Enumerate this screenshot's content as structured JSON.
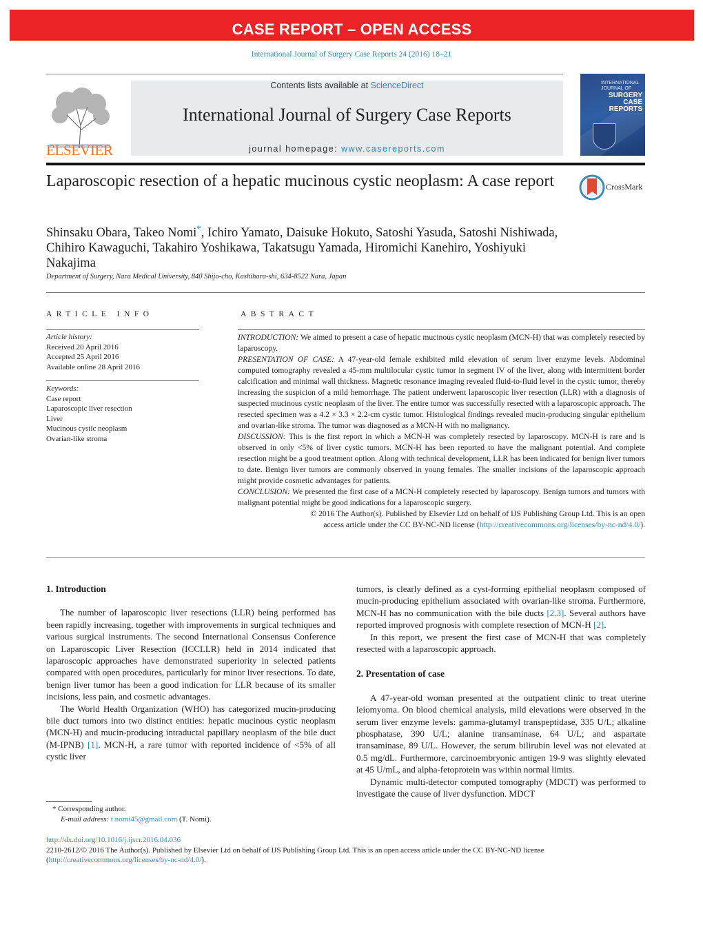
{
  "banner": "CASE REPORT – OPEN ACCESS",
  "citation": "International Journal of Surgery Case Reports 24 (2016) 18–21",
  "masthead": {
    "contents_prefix": "Contents lists available at ",
    "contents_link": "ScienceDirect",
    "journal_name": "International Journal of Surgery Case Reports",
    "homepage_prefix": "journal homepage: ",
    "homepage_link": "www.casereports.com",
    "publisher_logo": "ELSEVIER",
    "cover_line1": "INTERNATIONAL JOURNAL OF",
    "cover_line2": "SURGERY CASE REPORTS"
  },
  "article": {
    "title": "Laparoscopic resection of a hepatic mucinous cystic neoplasm: A case report",
    "crossmark_label": "CrossMark",
    "authors_part1": "Shinsaku Obara, Takeo Nomi",
    "corresponding_mark": "*",
    "authors_part2": ", Ichiro Yamato, Daisuke Hokuto, Satoshi Yasuda, Satoshi Nishiwada, Chihiro Kawaguchi, Takahiro Yoshikawa, Takatsugu Yamada, Hiromichi Kanehiro, Yoshiyuki Nakajima",
    "affiliation": "Department of Surgery, Nara Medical University, 840 Shijo-cho, Kashihara-shi, 634-8522 Nara, Japan"
  },
  "article_info": {
    "heading": "ARTICLE INFO",
    "history_label": "Article history:",
    "history": [
      "Received 20 April 2016",
      "Accepted 25 April 2016",
      "Available online 28 April 2016"
    ],
    "keywords_label": "Keywords:",
    "keywords": [
      "Case report",
      "Laparoscopic liver resection",
      "Liver",
      "Mucinous cystic neoplasm",
      "Ovarian-like stroma"
    ]
  },
  "abstract": {
    "heading": "ABSTRACT",
    "sections": [
      {
        "label": "INTRODUCTION:",
        "text": " We aimed to present a case of hepatic mucinous cystic neoplasm (MCN-H) that was completely resected by laparoscopy."
      },
      {
        "label": "PRESENTATION OF CASE:",
        "text": " A 47-year-old female exhibited mild elevation of serum liver enzyme levels. Abdominal computed tomography revealed a 45-mm multilocular cystic tumor in segment IV of the liver, along with intermittent border calcification and minimal wall thickness. Magnetic resonance imaging revealed fluid-to-fluid level in the cystic tumor, thereby increasing the suspicion of a mild hemorrhage. The patient underwent laparoscopic liver resection (LLR) with a diagnosis of suspected mucinous cystic neoplasm of the liver. The entire tumor was successfully resected with a laparoscopic approach. The resected specimen was a 4.2 × 3.3 × 2.2-cm cystic tumor. Histological findings revealed mucin-producing singular epithelium and ovarian-like stroma. The tumor was diagnosed as a MCN-H with no malignancy."
      },
      {
        "label": "DISCUSSION:",
        "text": " This is the first report in which a MCN-H was completely resected by laparoscopy. MCN-H is rare and is observed in only <5% of liver cystic tumors. MCN-H has been reported to have the malignant potential. And complete resection might be a good treatment option. Along with technical development, LLR has been indicated for benign liver tumors to date. Benign liver tumors are commonly observed in young females. The smaller incisions of the laparoscopic approach might provide cosmetic advantages for patients."
      },
      {
        "label": "CONCLUSION:",
        "text": " We presented the first case of a MCN-H completely resected by laparoscopy. Benign tumors and tumors with malignant potential might be good indications for a laparoscopic surgery."
      }
    ],
    "copyright_line1": "© 2016 The Author(s). Published by Elsevier Ltd on behalf of IJS Publishing Group Ltd. This is an open",
    "copyright_line2_prefix": "access article under the CC BY-NC-ND license (",
    "license_link": "http://creativecommons.org/licenses/by-nc-nd/4.0/",
    "copyright_line2_suffix": ")."
  },
  "body": {
    "intro_heading": "1.  Introduction",
    "intro_p1": "The number of laparoscopic liver resections (LLR) being performed has been rapidly increasing, together with improvements in surgical techniques and various surgical instruments. The second International Consensus Conference on Laparoscopic Liver Resection (ICCLLR) held in 2014 indicated that laparoscopic approaches have demonstrated superiority in selected patients compared with open procedures, particularly for minor liver resections. To date, benign liver tumor has been a good indication for LLR because of its smaller incisions, less pain, and cosmetic advantages.",
    "intro_p2_a": "The World Health Organization (WHO) has categorized mucin-producing bile duct tumors into two distinct entities: hepatic mucinous cystic neoplasm (MCN-H) and mucin-producing intraductal papillary neoplasm of the bile duct (M-IPNB) ",
    "ref1": "[1]",
    "intro_p2_b": ". MCN-H, a rare tumor with reported incidence of <5% of all cystic liver",
    "intro_p2_c": "tumors, is clearly defined as a cyst-forming epithelial neoplasm composed of mucin-producing epithelium associated with ovarian-like stroma. Furthermore, MCN-H has no communication with the bile ducts ",
    "ref23": "[2,3]",
    "intro_p2_d": ". Several authors have reported improved prognosis with complete resection of MCN-H ",
    "ref2": "[2]",
    "intro_p2_e": ".",
    "intro_p3": "In this report, we present the first case of MCN-H that was completely resected with a laparoscopic approach.",
    "case_heading": "2.  Presentation of case",
    "case_p1": "A 47-year-old woman presented at the outpatient clinic to treat uterine leiomyoma. On blood chemical analysis, mild elevations were observed in the serum liver enzyme levels: gamma-glutamyl transpeptidase, 335 U/L; alkaline phosphatase, 390 U/L; alanine transaminase, 64 U/L; and aspartate transaminase, 89 U/L. However, the serum bilirubin level was not elevated at 0.5 mg/dL. Furthermore, carcinoembryonic antigen 19-9 was slightly elevated at 45 U/mL, and alpha-fetoprotein was within normal limits.",
    "case_p2": "Dynamic multi-detector computed tomography (MDCT) was performed to investigate the cause of liver dysfunction. MDCT"
  },
  "footnote": {
    "mark": "*",
    "corresponding": " Corresponding author.",
    "email_label": "E-mail address:",
    "email": "t.nomi45@gmail.com",
    "email_suffix": " (T. Nomi)."
  },
  "bottom": {
    "doi": "http://dx.doi.org/10.1016/j.ijscr.2016.04.036",
    "issn_text": "2210-2612/© 2016 The Author(s). Published by Elsevier Ltd on behalf of IJS Publishing Group Ltd. This is an open access article under the CC BY-NC-ND license (",
    "license_link": "http://creativecommons.org/licenses/by-nc-nd/4.0/",
    "suffix": ")."
  },
  "colors": {
    "banner": "#ec2227",
    "link": "#2a8ab5",
    "elsevier_orange": "#f37021"
  }
}
